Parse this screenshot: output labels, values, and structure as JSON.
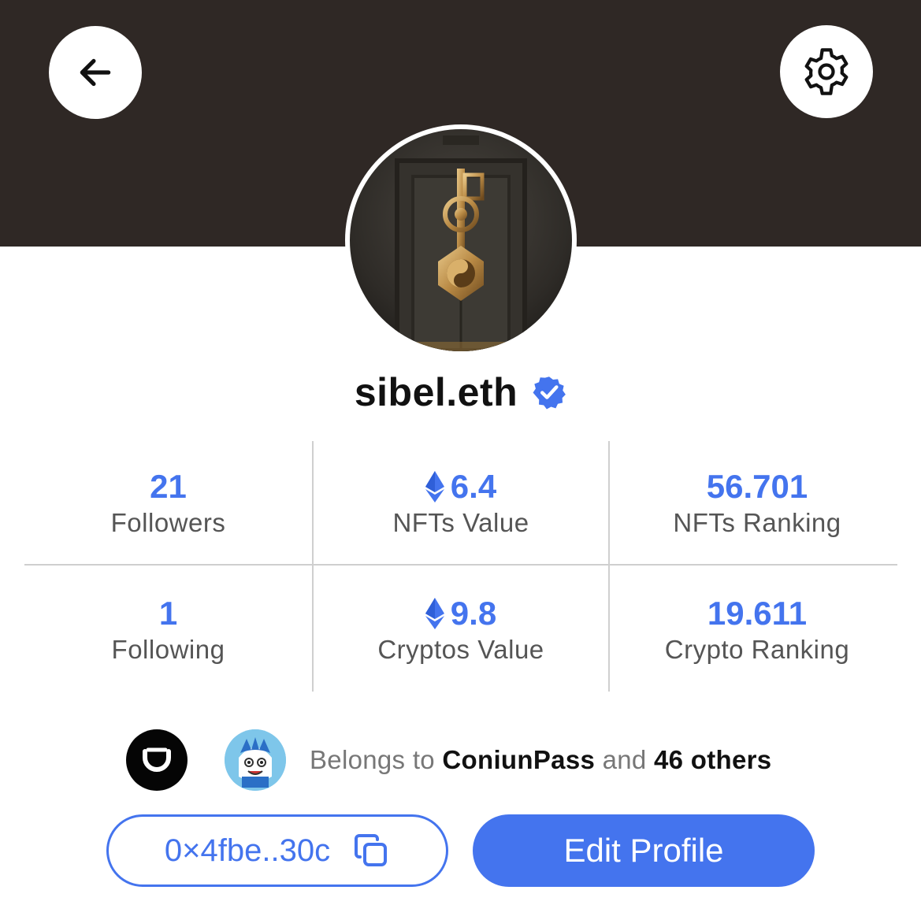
{
  "header": {
    "back_icon": "arrow-left-icon",
    "settings_icon": "gear-icon",
    "background_color": "#2f2825"
  },
  "profile": {
    "username": "sibel.eth",
    "verified": true,
    "verified_icon": "verified-badge-icon"
  },
  "stats": [
    {
      "value": "21",
      "label": "Followers",
      "eth": false
    },
    {
      "value": "6.4",
      "label": "NFTs Value",
      "eth": true
    },
    {
      "value": "56.701",
      "label": "NFTs Ranking",
      "eth": false
    },
    {
      "value": "1",
      "label": "Following",
      "eth": false
    },
    {
      "value": "9.8",
      "label": "Cryptos Value",
      "eth": true
    },
    {
      "value": "19.611",
      "label": "Crypto Ranking",
      "eth": false
    }
  ],
  "collections": {
    "prefix": "Belongs to",
    "name": "ConiunPass",
    "joiner": "and",
    "others": "46 others"
  },
  "wallet": {
    "address": "0×4fbe..30c",
    "copy_icon": "copy-icon"
  },
  "actions": {
    "edit_label": "Edit Profile"
  },
  "colors": {
    "accent": "#4474ee",
    "text": "#111111",
    "muted": "#555555"
  }
}
